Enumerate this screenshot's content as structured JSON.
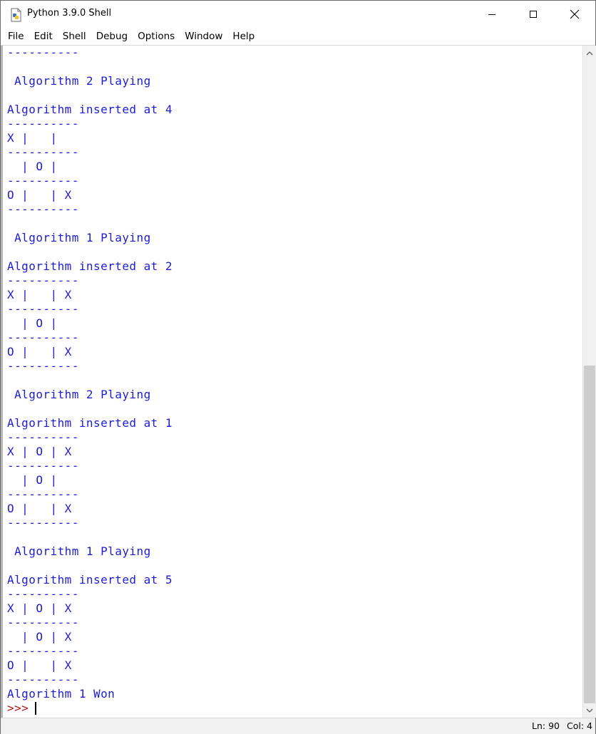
{
  "window": {
    "title": "Python 3.9.0 Shell",
    "icon": "python-file-icon",
    "controls": {
      "minimize": "minimize-icon",
      "maximize": "maximize-icon",
      "close": "close-icon"
    }
  },
  "menu": [
    "File",
    "Edit",
    "Shell",
    "Debug",
    "Options",
    "Window",
    "Help"
  ],
  "shell": {
    "lines": [
      "----------",
      "",
      " Algorithm 2 Playing",
      "",
      "Algorithm inserted at 4",
      "----------",
      "X |   |",
      "----------",
      "  | O |",
      "----------",
      "O |   | X",
      "----------",
      "",
      " Algorithm 1 Playing",
      "",
      "Algorithm inserted at 2",
      "----------",
      "X |   | X",
      "----------",
      "  | O |",
      "----------",
      "O |   | X",
      "----------",
      "",
      " Algorithm 2 Playing",
      "",
      "Algorithm inserted at 1",
      "----------",
      "X | O | X",
      "----------",
      "  | O |",
      "----------",
      "O |   | X",
      "----------",
      "",
      " Algorithm 1 Playing",
      "",
      "Algorithm inserted at 5",
      "----------",
      "X | O | X",
      "----------",
      "  | O | X",
      "----------",
      "O |   | X",
      "----------",
      "Algorithm 1 Won"
    ],
    "prompt": ">>>",
    "output_color": "#1c1cd8",
    "prompt_color": "#b31414"
  },
  "scrollbar": {
    "thumb_start_fraction": 0.475,
    "thumb_end_fraction": 1.0
  },
  "status": {
    "line": "Ln: 90",
    "col": "Col: 4"
  }
}
